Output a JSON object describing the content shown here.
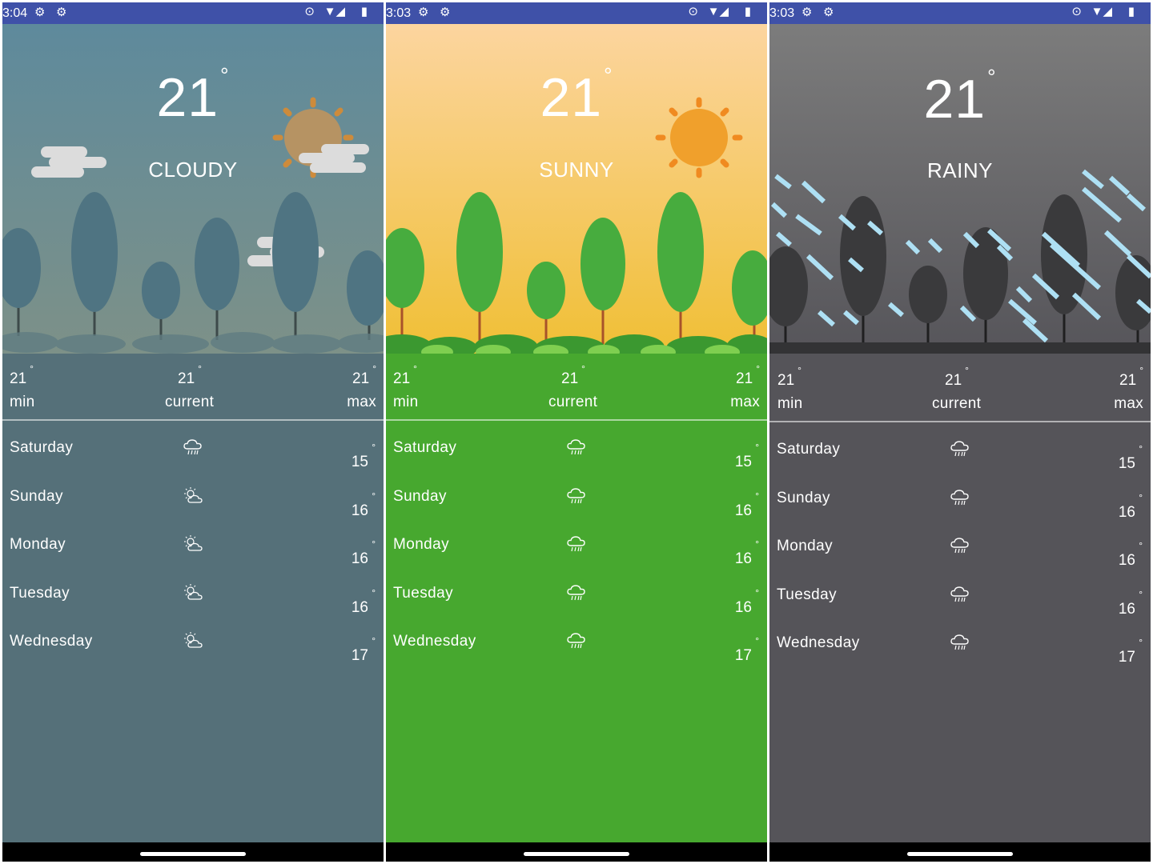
{
  "panels": [
    {
      "theme": "cloudy",
      "status_time": "3:04",
      "temperature": "21",
      "condition": "CLOUDY",
      "min_value": "21",
      "min_label": "min",
      "current_value": "21",
      "current_label": "current",
      "max_value": "21",
      "max_label": "max",
      "colors": {
        "sky_top": "#5e8a9c",
        "sky_bottom": "#7a8f88",
        "body": "#557079",
        "tree": "#4f7482"
      },
      "forecast": [
        {
          "day": "Saturday",
          "icon": "rain-cloud-icon",
          "temp": "15"
        },
        {
          "day": "Sunday",
          "icon": "partly-sunny-icon",
          "temp": "16"
        },
        {
          "day": "Monday",
          "icon": "partly-sunny-icon",
          "temp": "16"
        },
        {
          "day": "Tuesday",
          "icon": "partly-sunny-icon",
          "temp": "16"
        },
        {
          "day": "Wednesday",
          "icon": "partly-sunny-icon",
          "temp": "17"
        }
      ]
    },
    {
      "theme": "sunny",
      "status_time": "3:03",
      "temperature": "21",
      "condition": "SUNNY",
      "min_value": "21",
      "min_label": "min",
      "current_value": "21",
      "current_label": "current",
      "max_value": "21",
      "max_label": "max",
      "colors": {
        "sky_top": "#fcd49c",
        "sky_bottom": "#f1c13a",
        "body": "#47a82f",
        "tree": "#47ac3e"
      },
      "forecast": [
        {
          "day": "Saturday",
          "icon": "rain-cloud-icon",
          "temp": "15"
        },
        {
          "day": "Sunday",
          "icon": "rain-cloud-icon",
          "temp": "16"
        },
        {
          "day": "Monday",
          "icon": "rain-cloud-icon",
          "temp": "16"
        },
        {
          "day": "Tuesday",
          "icon": "rain-cloud-icon",
          "temp": "16"
        },
        {
          "day": "Wednesday",
          "icon": "rain-cloud-icon",
          "temp": "17"
        }
      ]
    },
    {
      "theme": "rainy",
      "status_time": "3:03",
      "temperature": "21",
      "condition": "RAINY",
      "min_value": "21",
      "min_label": "min",
      "current_value": "21",
      "current_label": "current",
      "max_value": "21",
      "max_label": "max",
      "colors": {
        "sky_top": "#7b7b7b",
        "sky_bottom": "#58575b",
        "body": "#555459",
        "tree": "#3a3a3c"
      },
      "forecast": [
        {
          "day": "Saturday",
          "icon": "rain-cloud-icon",
          "temp": "15"
        },
        {
          "day": "Sunday",
          "icon": "rain-cloud-icon",
          "temp": "16"
        },
        {
          "day": "Monday",
          "icon": "rain-cloud-icon",
          "temp": "16"
        },
        {
          "day": "Tuesday",
          "icon": "rain-cloud-icon",
          "temp": "16"
        },
        {
          "day": "Wednesday",
          "icon": "rain-cloud-icon",
          "temp": "17"
        }
      ]
    }
  ]
}
